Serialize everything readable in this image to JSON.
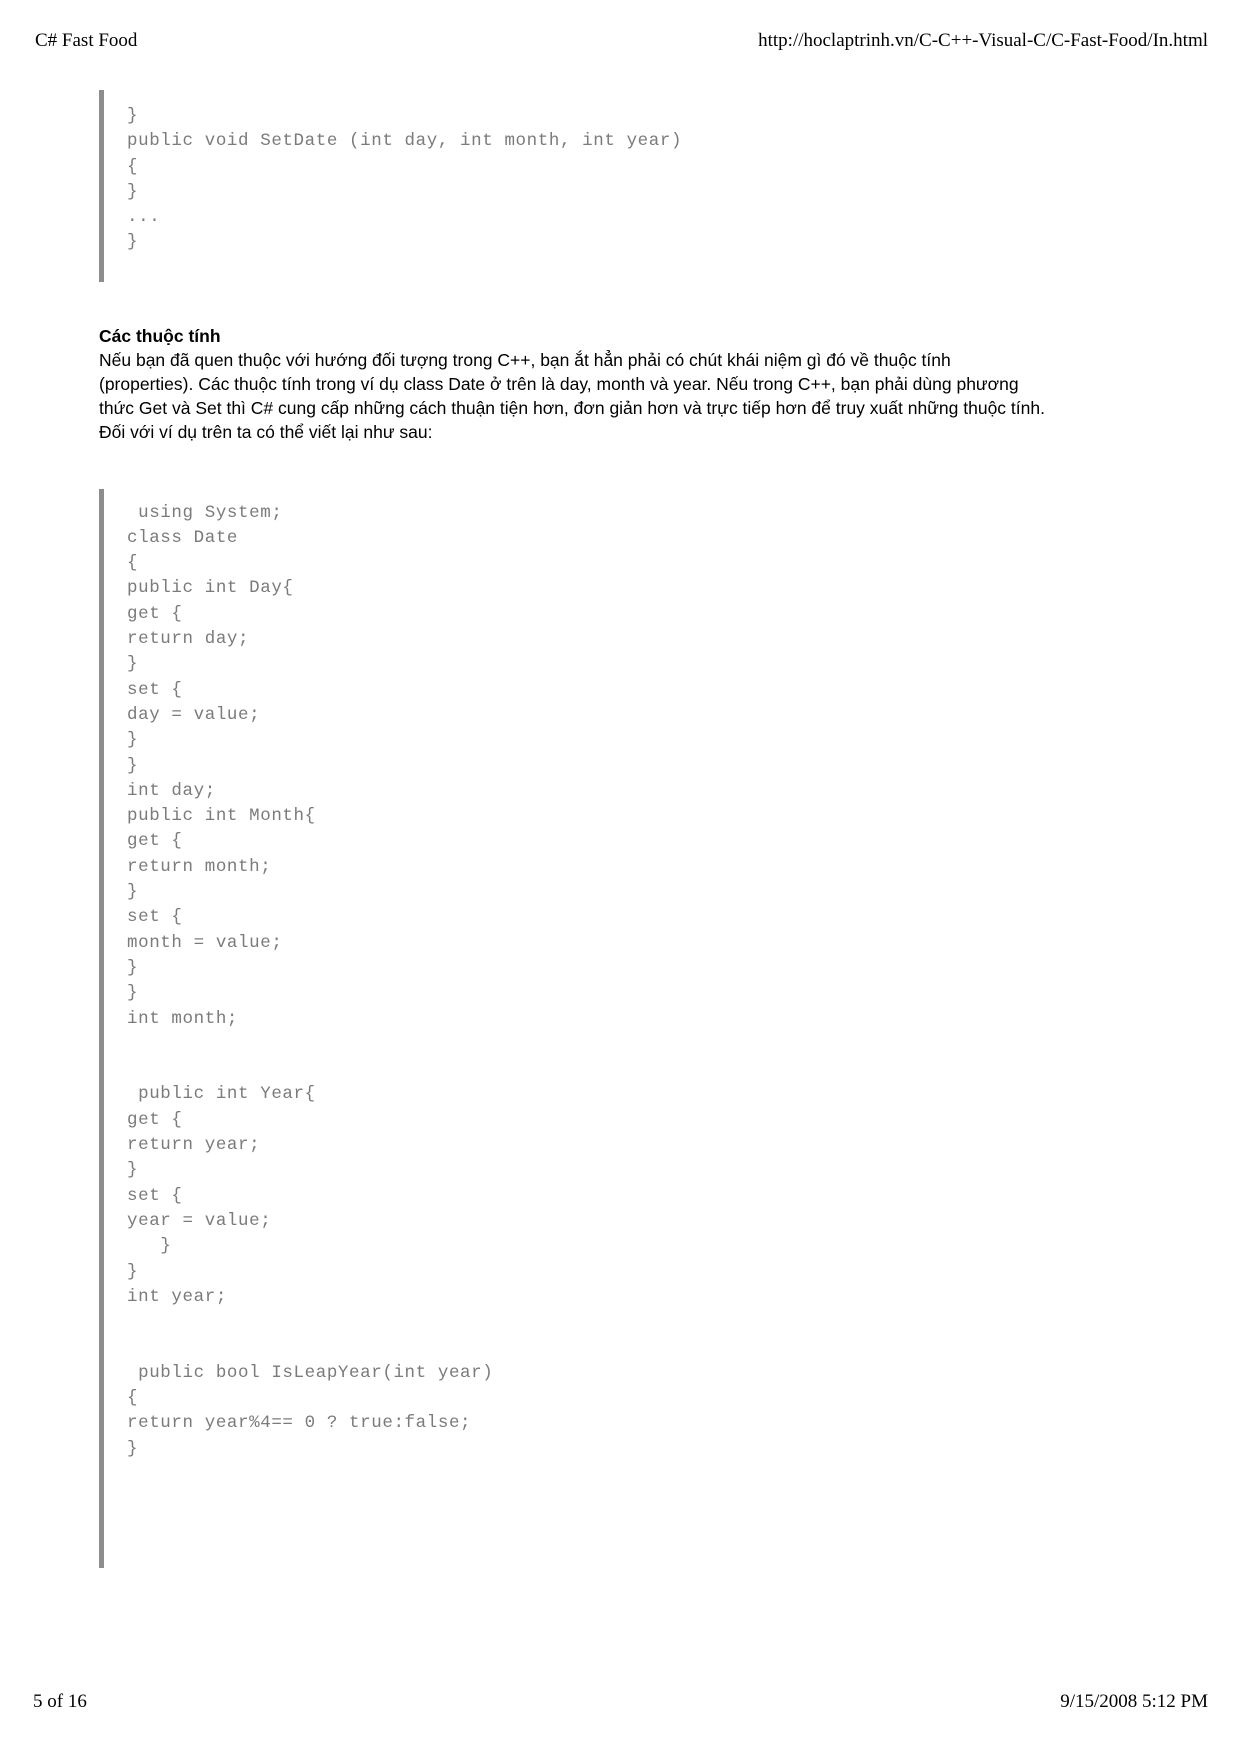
{
  "header": {
    "document_title": "C# Fast Food",
    "url": "http://hoclaptrinh.vn/C-C++-Visual-C/C-Fast-Food/In.html"
  },
  "footer": {
    "page_label": "5 of 16",
    "timestamp": "9/15/2008 5:12 PM"
  },
  "code_block_1": {
    "lines": [
      "}",
      "public void SetDate (int day, int month, int year)",
      "{",
      "}",
      "...",
      "}"
    ]
  },
  "section": {
    "heading": "Các thuộc tính",
    "paragraph_lines": [
      "Nếu bạn đã quen thuộc với hướng đối tượng trong C++, bạn ắt hẳn phải có chút khái niệm gì đó về thuộc tính",
      "(properties). Các thuộc tính trong ví dụ class Date ở trên là day, month và year. Nếu trong C++, bạn phải dùng phương",
      "thức Get và Set thì C# cung cấp những cách thuận tiện hơn, đơn giản hơn và trực tiếp hơn để truy xuất những thuộc tính.",
      "Đối với ví dụ trên ta có thể viết lại như sau:"
    ]
  },
  "code_block_2": {
    "lines": [
      " using System;",
      "class Date",
      "{",
      "public int Day{",
      "get {",
      "return day;",
      "}",
      "set {",
      "day = value;",
      "}",
      "}",
      "int day;",
      "public int Month{",
      "get {",
      "return month;",
      "}",
      "set {",
      "month = value;",
      "}",
      "}",
      "int month;",
      "",
      "",
      " public int Year{",
      "get {",
      "return year;",
      "}",
      "set {",
      "year = value;",
      "   }",
      "}",
      "int year;",
      "",
      "",
      " public bool IsLeapYear(int year)",
      "{",
      "return year%4== 0 ? true:false;",
      "}",
      "",
      "",
      ""
    ]
  },
  "colors": {
    "code_text": "#7b7b7b",
    "code_bar": "#8d8d8d",
    "body_text": "#000000",
    "page_background": "#ffffff"
  }
}
